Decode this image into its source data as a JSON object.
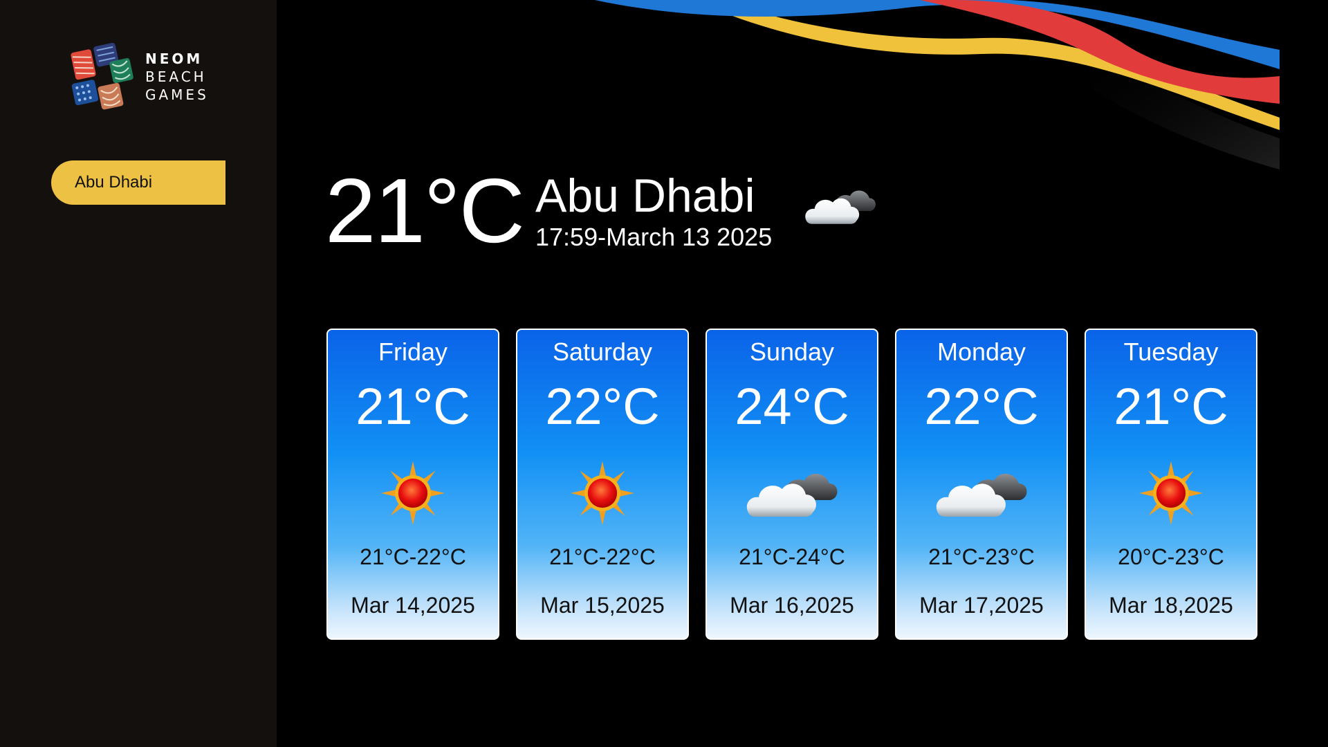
{
  "brand": {
    "line1": "NEOM",
    "line2": "BEACH",
    "line3": "GAMES",
    "colors": {
      "pill": "#edc143",
      "sidebar": "#14100d",
      "card_top": "#0a63e8",
      "card_bottom": "#eef7ff"
    }
  },
  "sidebar": {
    "cities": [
      {
        "label": "Abu Dhabi",
        "selected": true
      }
    ]
  },
  "current": {
    "temp": "21°C",
    "city": "Abu Dhabi",
    "datetime": "17:59-March 13 2025",
    "icon": "partly-cloudy-icon"
  },
  "forecast": [
    {
      "day": "Friday",
      "temp": "21°C",
      "icon": "sun-icon",
      "range": "21°C-22°C",
      "date": "Mar 14,2025"
    },
    {
      "day": "Saturday",
      "temp": "22°C",
      "icon": "sun-icon",
      "range": "21°C-22°C",
      "date": "Mar 15,2025"
    },
    {
      "day": "Sunday",
      "temp": "24°C",
      "icon": "partly-cloudy-icon",
      "range": "21°C-24°C",
      "date": "Mar 16,2025"
    },
    {
      "day": "Monday",
      "temp": "22°C",
      "icon": "partly-cloudy-icon",
      "range": "21°C-23°C",
      "date": "Mar 17,2025"
    },
    {
      "day": "Tuesday",
      "temp": "21°C",
      "icon": "sun-icon",
      "range": "20°C-23°C",
      "date": "Mar 18,2025"
    }
  ]
}
